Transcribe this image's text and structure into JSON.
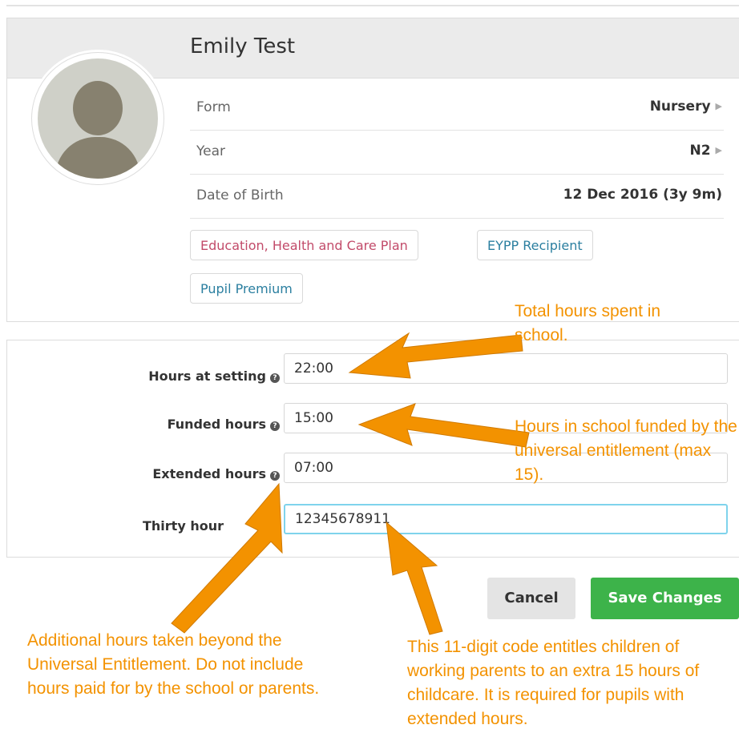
{
  "student": {
    "name": "Emily Test",
    "details": [
      {
        "label": "Form",
        "value": "Nursery"
      },
      {
        "label": "Year",
        "value": "N2"
      },
      {
        "label": "Date of Birth",
        "value": "12 Dec 2016 (3y 9m)"
      }
    ],
    "tags": [
      "Education, Health and Care Plan",
      "EYPP Recipient",
      "Pupil Premium"
    ]
  },
  "hours_form": {
    "hours_at_setting": {
      "label": "Hours at setting",
      "value": "22:00"
    },
    "funded_hours": {
      "label": "Funded hours",
      "value": "15:00"
    },
    "extended_hours": {
      "label": "Extended hours",
      "value": "07:00"
    },
    "thirty_hours": {
      "label": "Thirty hour",
      "value": "12345678911"
    }
  },
  "buttons": {
    "cancel": "Cancel",
    "save": "Save Changes"
  },
  "annotations": {
    "total_hours": "Total hours spent in school.",
    "funded": "Hours in school funded by the universal entitlement (max 15).",
    "additional": "Additional hours taken beyond the Universal Entitlement. Do not include hours paid for by the school or parents.",
    "code": "This 11-digit code entitles children of working parents to an extra 15 hours of childcare. It is required for pupils with extended hours."
  },
  "colors": {
    "accent_orange": "#f39200",
    "save_green": "#3db34a",
    "focus_blue": "#7fd3ec"
  }
}
